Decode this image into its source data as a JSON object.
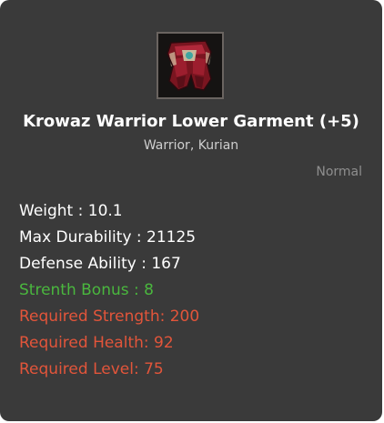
{
  "item": {
    "name": "Krowaz Warrior Lower Garment (+5)",
    "classes": "Warrior, Kurian",
    "grade": "Normal",
    "icon": "armor-lower-garment-icon"
  },
  "stats": [
    {
      "text": "Weight : 10.1",
      "color": "#ffffff"
    },
    {
      "text": "Max Durability : 21125",
      "color": "#ffffff"
    },
    {
      "text": "Defense Ability : 167",
      "color": "#ffffff"
    },
    {
      "text": "Strenth Bonus : 8",
      "color": "#4ab73e"
    },
    {
      "text": "Required Strength: 200",
      "color": "#e2553a"
    },
    {
      "text": "Required Health: 92",
      "color": "#e2553a"
    },
    {
      "text": "Required Level: 75",
      "color": "#e2553a"
    }
  ],
  "colors": {
    "panel_background": "#3a3a3a",
    "bonus": "#4ab73e",
    "requirement": "#e2553a",
    "grade": "#8e8e8e"
  }
}
